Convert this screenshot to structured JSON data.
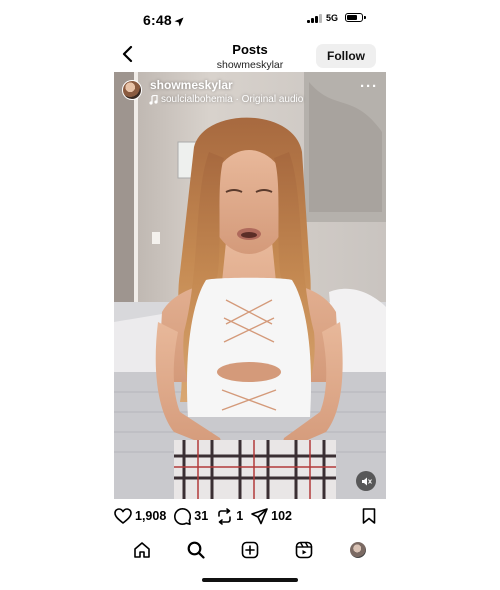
{
  "status": {
    "time": "6:48",
    "network": "5G",
    "battery_percent": 75
  },
  "header": {
    "title": "Posts",
    "subtitle": "showmeskylar",
    "follow_label": "Follow"
  },
  "post": {
    "username": "showmeskylar",
    "audio": "soulcialbohemia · Original audio",
    "more_label": "···"
  },
  "actions": {
    "likes": "1,908",
    "comments": "31",
    "reposts": "1",
    "shares": "102"
  },
  "tabbar": {
    "icons": [
      "home-icon",
      "search-icon",
      "create-icon",
      "reels-icon",
      "profile-avatar"
    ]
  },
  "colors": {
    "follow_bg": "#efefef",
    "text": "#000000"
  }
}
